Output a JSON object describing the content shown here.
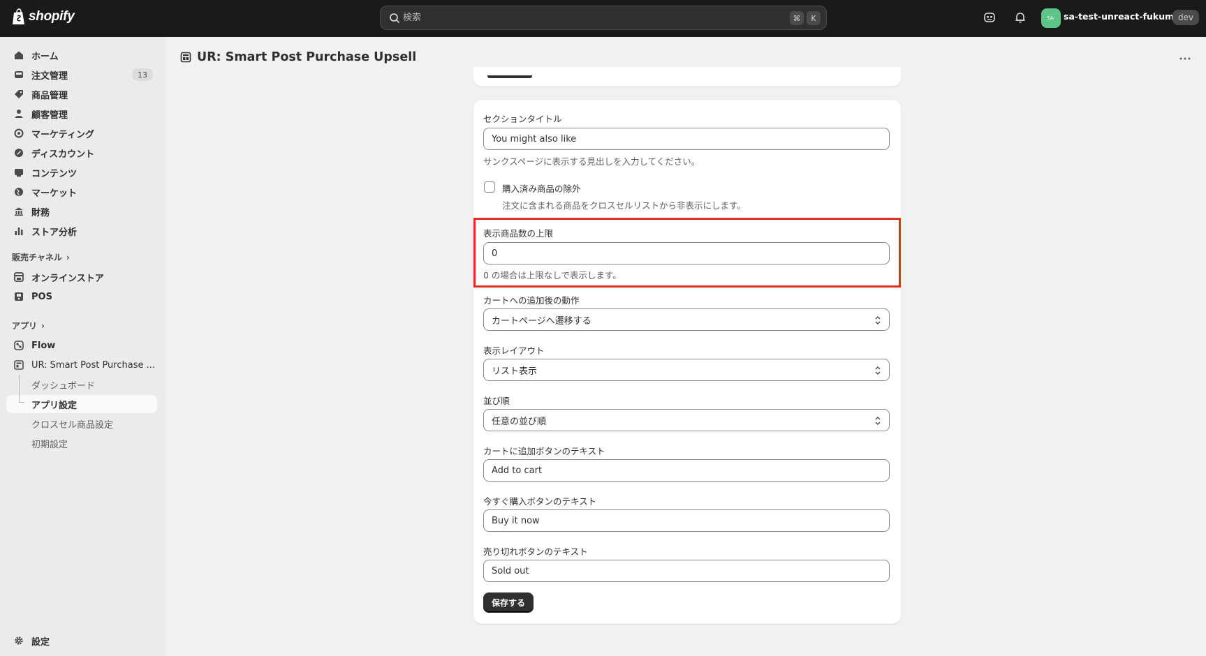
{
  "topbar": {
    "logo_text": "shopify",
    "search_placeholder": "検索",
    "shortcut_key1": "⌘",
    "shortcut_key2": "K",
    "avatar_initials": "SA-",
    "store_name": "sa-test-unreact-fukumoto",
    "env_badge": "dev"
  },
  "sidebar": {
    "items": [
      {
        "label": "ホーム",
        "icon": "home-icon"
      },
      {
        "label": "注文管理",
        "icon": "inbox-icon",
        "count": "13"
      },
      {
        "label": "商品管理",
        "icon": "tag-icon"
      },
      {
        "label": "顧客管理",
        "icon": "person-icon"
      },
      {
        "label": "マーケティング",
        "icon": "target-icon"
      },
      {
        "label": "ディスカウント",
        "icon": "discount-icon"
      },
      {
        "label": "コンテンツ",
        "icon": "content-icon"
      },
      {
        "label": "マーケット",
        "icon": "globe-icon"
      },
      {
        "label": "財務",
        "icon": "bank-icon"
      },
      {
        "label": "ストア分析",
        "icon": "chart-icon"
      }
    ],
    "sales_channels_heading": "販売チャネル",
    "channels": [
      {
        "label": "オンラインストア",
        "icon": "store-icon"
      },
      {
        "label": "POS",
        "icon": "pos-icon"
      }
    ],
    "apps_heading": "アプリ",
    "apps": [
      {
        "label": "Flow",
        "icon": "flow-icon"
      },
      {
        "label": "UR: Smart Post Purchase ...",
        "icon": "app-icon"
      }
    ],
    "app_subitems": [
      {
        "label": "ダッシュボード"
      },
      {
        "label": "アプリ設定"
      },
      {
        "label": "クロスセル商品設定"
      },
      {
        "label": "初期設定"
      }
    ],
    "settings_label": "設定"
  },
  "page": {
    "title": "UR: Smart Post Purchase Upsell"
  },
  "form": {
    "section_title_label": "セクションタイトル",
    "section_title_value": "You might also like",
    "section_title_help": "サンクスページに表示する見出しを入力してください。",
    "exclude_label": "購入済み商品の除外",
    "exclude_help": "注文に含まれる商品をクロスセルリストから非表示にします。",
    "limit_label": "表示商品数の上限",
    "limit_value": "0",
    "limit_help": "0 の場合は上限なしで表示します。",
    "after_add_label": "カートへの追加後の動作",
    "after_add_value": "カートページへ遷移する",
    "layout_label": "表示レイアウト",
    "layout_value": "リスト表示",
    "sort_label": "並び順",
    "sort_value": "任意の並び順",
    "add_to_cart_label": "カートに追加ボタンのテキスト",
    "add_to_cart_value": "Add to cart",
    "buy_now_label": "今すぐ購入ボタンのテキスト",
    "buy_now_value": "Buy it now",
    "sold_out_label": "売り切れボタンのテキスト",
    "sold_out_value": "Sold out",
    "save_label": "保存する"
  },
  "colors": {
    "topbar_bg": "#1a1a1a",
    "highlight": "#e0331f",
    "avatar_bg": "#5ec589",
    "primary_button": "#303030"
  }
}
